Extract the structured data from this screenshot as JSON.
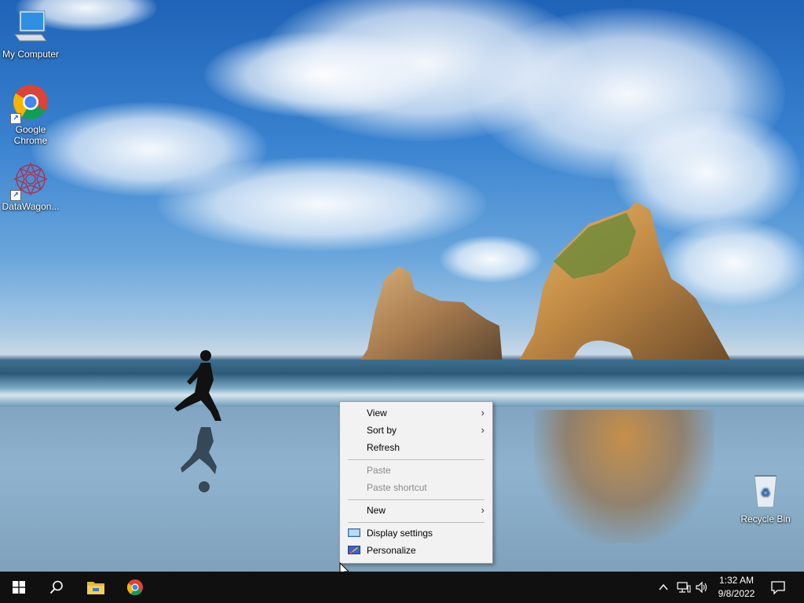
{
  "desktop": {
    "icons": [
      {
        "label": "My Computer"
      },
      {
        "label": "Google Chrome"
      },
      {
        "label": "DataWagon..."
      },
      {
        "label": "Recycle Bin"
      }
    ]
  },
  "context_menu": {
    "items": [
      {
        "label": "View",
        "has_submenu": true,
        "enabled": true
      },
      {
        "label": "Sort by",
        "has_submenu": true,
        "enabled": true
      },
      {
        "label": "Refresh",
        "has_submenu": false,
        "enabled": true
      },
      {
        "label": "Paste",
        "has_submenu": false,
        "enabled": false
      },
      {
        "label": "Paste shortcut",
        "has_submenu": false,
        "enabled": false
      },
      {
        "label": "New",
        "has_submenu": true,
        "enabled": true
      },
      {
        "label": "Display settings",
        "icon": "display-settings-icon",
        "enabled": true
      },
      {
        "label": "Personalize",
        "icon": "personalize-icon",
        "enabled": true
      }
    ],
    "submenu_glyph": "›"
  },
  "taskbar": {
    "pinned": [
      "windows-start-icon",
      "search-icon",
      "file-explorer-icon",
      "chrome-icon"
    ],
    "tray_icons": [
      "chevron-up-icon",
      "network-icon",
      "volume-icon"
    ],
    "clock": {
      "time": "1:32 AM",
      "date": "9/8/2022"
    },
    "notification_icon": "action-center-icon"
  },
  "colors": {
    "taskbar": "#101010",
    "menu_bg": "#f2f2f2",
    "menu_disabled_text": "#8a8a8a"
  }
}
